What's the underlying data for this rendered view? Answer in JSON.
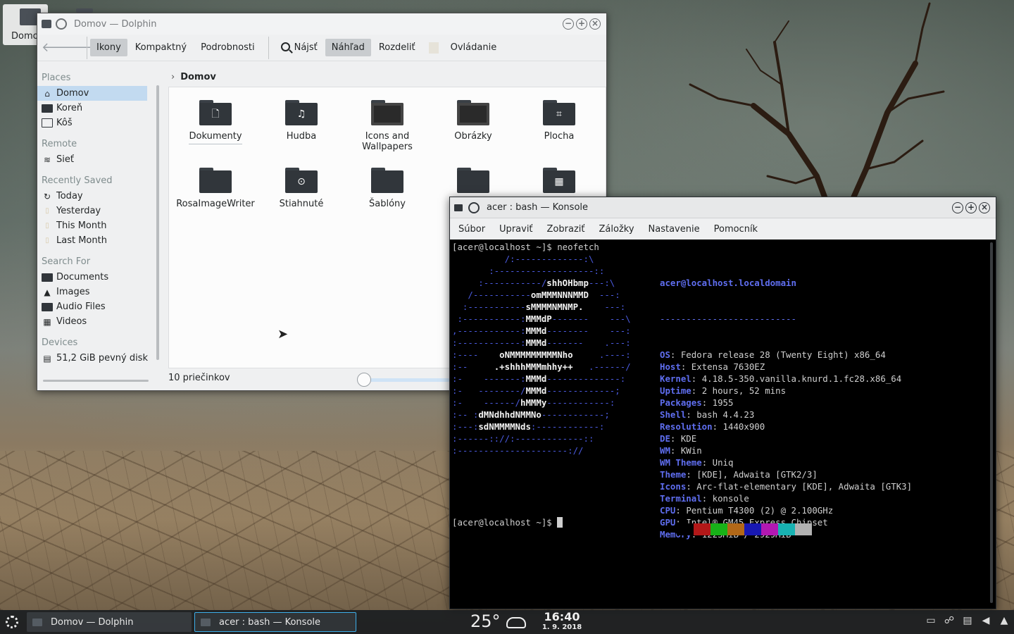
{
  "desktop": {
    "icon_label": "Domo"
  },
  "dolphin": {
    "title": "Domov — Dolphin",
    "toolbar": {
      "icons": "Ikony",
      "compact": "Kompaktný",
      "details": "Podrobnosti",
      "find": "Nájsť",
      "preview": "Náhľad",
      "split": "Rozdeliť",
      "control": "Ovládanie"
    },
    "sidebar": {
      "places_head": "Places",
      "places": [
        "Domov",
        "Koreň",
        "Kôš"
      ],
      "remote_head": "Remote",
      "remote": [
        "Sieť"
      ],
      "recent_head": "Recently Saved",
      "recent": [
        "Today",
        "Yesterday",
        "This Month",
        "Last Month"
      ],
      "search_head": "Search For",
      "search": [
        "Documents",
        "Images",
        "Audio Files",
        "Videos"
      ],
      "devices_head": "Devices",
      "devices": [
        "51,2 GiB pevný disk"
      ]
    },
    "breadcrumb": "Domov",
    "files": [
      "Dokumenty",
      "Hudba",
      "Icons and Wallpapers",
      "Obrázky",
      "Plocha",
      "RosaImageWriter",
      "Stiahnuté",
      "Šablóny"
    ],
    "status": "10 priečinkov"
  },
  "konsole": {
    "title": "acer : bash — Konsole",
    "menu": [
      "Súbor",
      "Upraviť",
      "Zobraziť",
      "Záložky",
      "Nastavenie",
      "Pomocník"
    ],
    "command_line": "[acer@localhost ~]$ neofetch",
    "prompt": "[acer@localhost ~]$ ",
    "neofetch": {
      "header": "acer@localhost.localdomain",
      "rule": "--------------------------",
      "rows": [
        {
          "k": "OS",
          "v": "Fedora release 28 (Twenty Eight) x86_64"
        },
        {
          "k": "Host",
          "v": "Extensa 7630EZ"
        },
        {
          "k": "Kernel",
          "v": "4.18.5-350.vanilla.knurd.1.fc28.x86_64"
        },
        {
          "k": "Uptime",
          "v": "2 hours, 52 mins"
        },
        {
          "k": "Packages",
          "v": "1955"
        },
        {
          "k": "Shell",
          "v": "bash 4.4.23"
        },
        {
          "k": "Resolution",
          "v": "1440x900"
        },
        {
          "k": "DE",
          "v": "KDE"
        },
        {
          "k": "WM",
          "v": "KWin"
        },
        {
          "k": "WM Theme",
          "v": "Uniq"
        },
        {
          "k": "Theme",
          "v": "[KDE], Adwaita [GTK2/3]"
        },
        {
          "k": "Icons",
          "v": "Arc-flat-elementary [KDE], Adwaita [GTK3]"
        },
        {
          "k": "Terminal",
          "v": "konsole"
        },
        {
          "k": "CPU",
          "v": "Pentium T4300 (2) @ 2.100GHz"
        },
        {
          "k": "GPU",
          "v": "Intel® GM45 Express Chipset"
        },
        {
          "k": "Memory",
          "v": "1225MiB / 2929MiB"
        }
      ],
      "ascii": [
        "          /:-------------:\\",
        "       :-------------------::",
        "     :-----------/shhOHbmp---:\\",
        "   /-----------omMMMNNNMMD  ---:",
        "  :-----------sMMMMNMNMP.    ---:",
        " :-----------:MMMdP-------    ---\\",
        ",------------:MMMd--------    ---:",
        ":------------:MMMd-------    .---:",
        ":----    oNMMMMMMMMMNho     .----:",
        ":--     .+shhhMMMmhhy++   .------/",
        ":-    -------:MMMd--------------:",
        ":-   --------/MMMd-------------;",
        ":-    ------/hMMMy------------:",
        ":-- :dMNdhhdNMMNo------------;",
        ":---:sdNMMMMNds:------------:",
        ":------:://:-------------::",
        ":---------------------://"
      ],
      "palette": [
        "#000000",
        "#b21818",
        "#18b218",
        "#b26818",
        "#1818b2",
        "#b218b2",
        "#18b2b2",
        "#b2b2b2"
      ]
    }
  },
  "taskbar": {
    "tasks": [
      "Domov — Dolphin",
      "acer : bash — Konsole"
    ],
    "temperature": "25°",
    "time": "16:40",
    "date": "1. 9. 2018"
  }
}
